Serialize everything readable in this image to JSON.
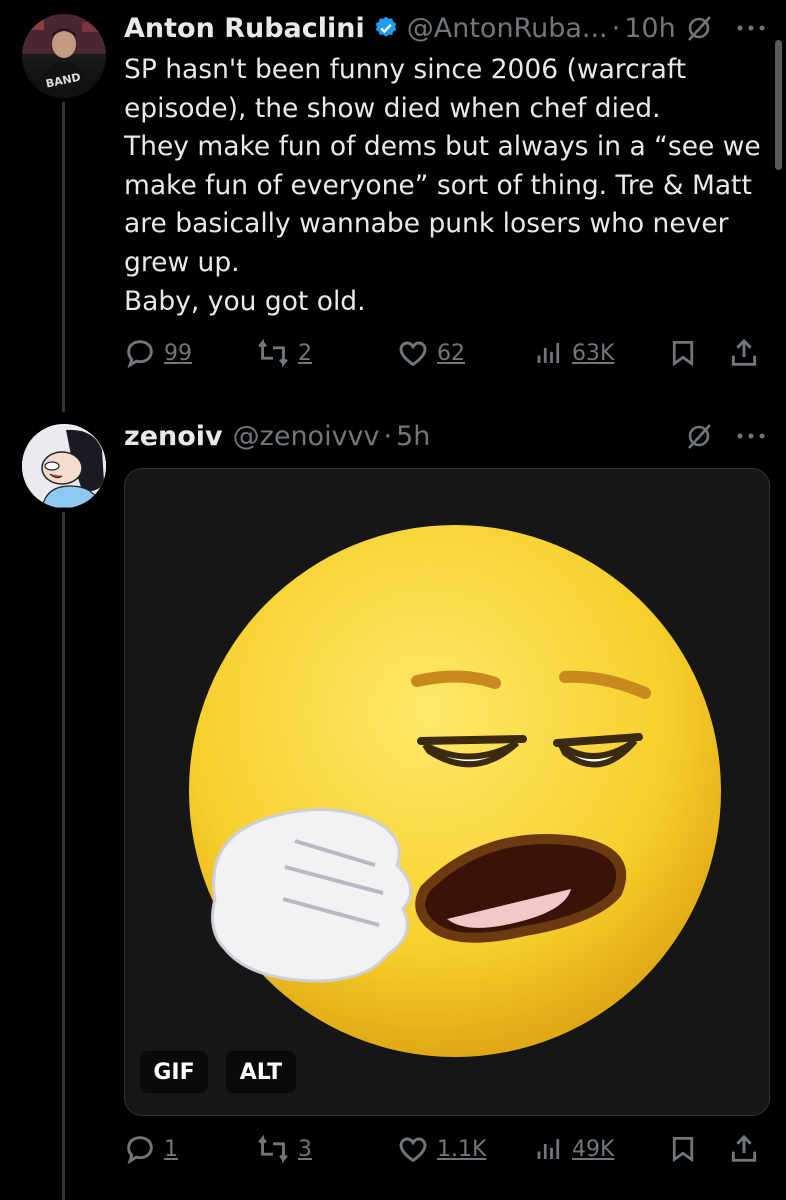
{
  "tweets": [
    {
      "display_name": "Anton Rubaclini",
      "handle": "@AntonRuba...",
      "separator": "·",
      "time": "10h",
      "lines": [
        "SP hasn't been funny since 2006 (warcraft",
        "episode), the show died when chef died.",
        "They make fun of dems but always in a “see we",
        "make fun of everyone” sort of thing. Tre & Matt",
        "are basically wannabe punk losers who never",
        "grew up.",
        "Baby, you got old."
      ],
      "replies": "99",
      "reposts": "2",
      "likes": "62",
      "views": "63K",
      "avatar_text": "BAND"
    },
    {
      "display_name": "zenoiv",
      "handle": "@zenoivvv",
      "separator": "·",
      "time": "5h",
      "media_badges": {
        "gif": "GIF",
        "alt": "ALT"
      },
      "replies": "1",
      "reposts": "3",
      "likes": "1.1K",
      "views": "49K"
    }
  ],
  "colors": {
    "background": "#000000",
    "text": "#e7e9ea",
    "muted": "#71767b",
    "verified": "#1d9bf0"
  },
  "icons": [
    "verified-badge-icon",
    "grok-icon",
    "more-icon",
    "reply-icon",
    "repost-icon",
    "like-icon",
    "views-icon",
    "bookmark-icon",
    "share-icon"
  ]
}
